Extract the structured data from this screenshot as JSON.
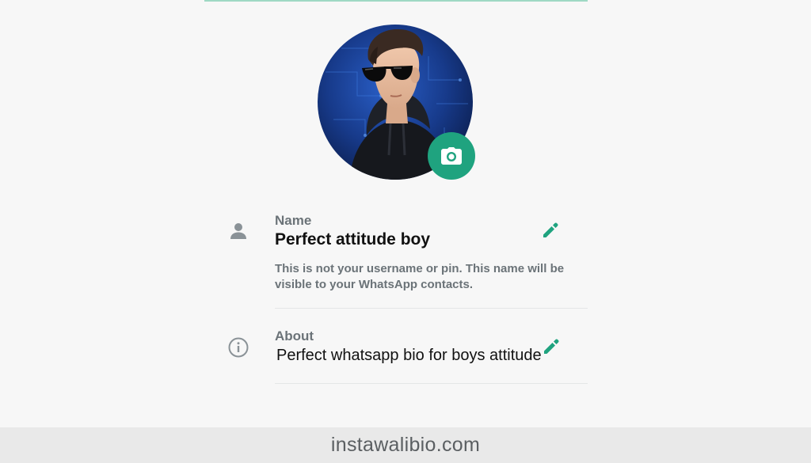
{
  "profile": {
    "photo_alt": "Profile photo",
    "camera_icon": "camera-icon"
  },
  "name_section": {
    "icon": "person-icon",
    "label": "Name",
    "value": "Perfect attitude boy",
    "helper": "This is not your username or pin. This name will be visible to your WhatsApp contacts.",
    "edit_icon": "pencil-icon"
  },
  "about_section": {
    "icon": "info-icon",
    "label": "About",
    "value": "Perfect whatsapp bio for boys attitude",
    "edit_icon": "pencil-icon"
  },
  "footer": {
    "watermark": "instawalibio.com"
  },
  "colors": {
    "accent": "#1fa37f",
    "muted_text": "#6b7378",
    "background": "#f7f7f7"
  }
}
